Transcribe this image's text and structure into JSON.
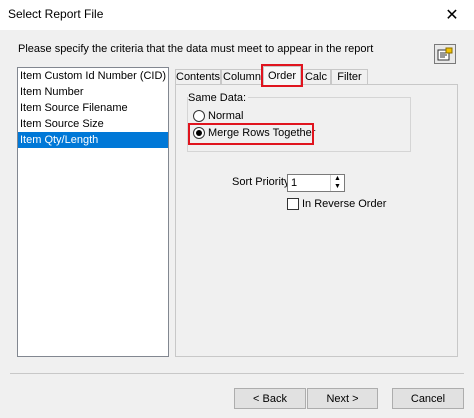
{
  "window": {
    "title": "Select Report File",
    "close_glyph": "✕"
  },
  "instruction": "Please specify the criteria that the data must meet to appear in the report",
  "help_icon": "report-help-icon",
  "fields": [
    {
      "label": "Item Custom Id Number (CID)",
      "selected": false
    },
    {
      "label": "Item Number",
      "selected": false
    },
    {
      "label": "Item Source Filename",
      "selected": false
    },
    {
      "label": "Item Source Size",
      "selected": false
    },
    {
      "label": "Item Qty/Length",
      "selected": true
    }
  ],
  "tabs": [
    "Contents",
    "Column",
    "Order",
    "Calc",
    "Filter"
  ],
  "active_tab": "Order",
  "same_data": {
    "label": "Same Data:",
    "options": [
      {
        "label": "Normal",
        "checked": false
      },
      {
        "label": "Merge Rows Together",
        "checked": true
      }
    ]
  },
  "sort_priority": {
    "label": "Sort Priority",
    "value": "1"
  },
  "reverse_order": {
    "label": "In Reverse Order",
    "checked": false
  },
  "buttons": {
    "back": "< Back",
    "next": "Next >",
    "cancel": "Cancel"
  },
  "highlight_color": "#e0141e",
  "selection_color": "#0078d7"
}
